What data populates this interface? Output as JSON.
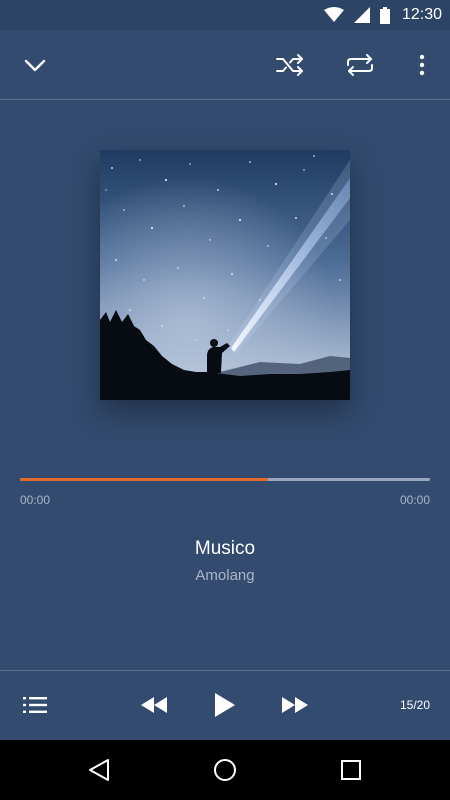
{
  "status_bar": {
    "time": "12:30"
  },
  "player": {
    "track_title": "Musico",
    "artist": "Amolang",
    "elapsed": "00:00",
    "duration": "00:00",
    "progress_fraction": 0.605,
    "track_counter": "15/20"
  },
  "colors": {
    "background": "#324b6e",
    "progress_fill": "#e06a2c",
    "progress_track": "#9aa8be"
  },
  "icons": {
    "toolbar": [
      "chevron-down-icon",
      "shuffle-icon",
      "repeat-icon",
      "more-vert-icon"
    ],
    "controls": [
      "queue-list-icon",
      "rewind-icon",
      "play-icon",
      "fast-forward-icon"
    ],
    "navigation": [
      "back-icon",
      "home-icon",
      "recents-icon"
    ]
  }
}
